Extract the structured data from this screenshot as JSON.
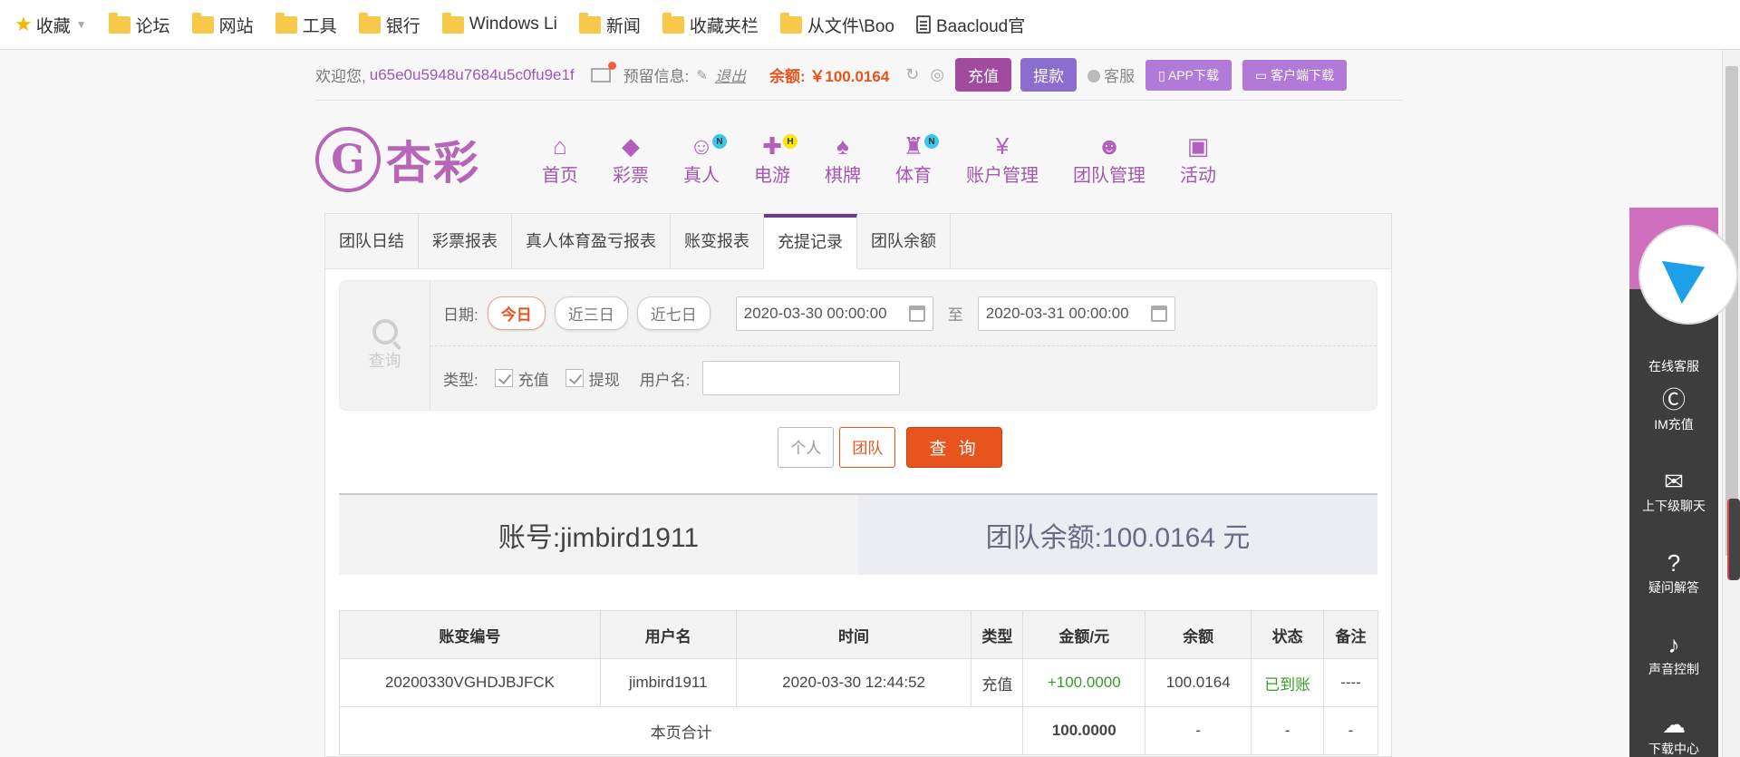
{
  "bookmarks": {
    "favorites": "收藏",
    "items": [
      "论坛",
      "网站",
      "工具",
      "银行",
      "Windows Li",
      "新闻",
      "收藏夹栏",
      "从文件\\Boo",
      "Baacloud官"
    ]
  },
  "topbar": {
    "welcome": "欢迎您,",
    "username": "u65e0u5948u7684u5c0fu9e1f",
    "reserve_label": "预留信息:",
    "logout": "退出",
    "balance": "余额: ￥100.0164",
    "recharge": "充值",
    "withdraw": "提款",
    "service": "客服",
    "app_download": "APP下载",
    "client_download": "客户端下载"
  },
  "logo": {
    "mark": "G",
    "text": "杏彩"
  },
  "nav": [
    {
      "label": "首页",
      "icon": "⌂",
      "badge": ""
    },
    {
      "label": "彩票",
      "icon": "◆",
      "badge": ""
    },
    {
      "label": "真人",
      "icon": "☺",
      "badge": "N"
    },
    {
      "label": "电游",
      "icon": "✚",
      "badge": "H"
    },
    {
      "label": "棋牌",
      "icon": "♠",
      "badge": ""
    },
    {
      "label": "体育",
      "icon": "♜",
      "badge": "N"
    },
    {
      "label": "账户管理",
      "icon": "¥",
      "badge": ""
    },
    {
      "label": "团队管理",
      "icon": "☻",
      "badge": ""
    },
    {
      "label": "活动",
      "icon": "▣",
      "badge": ""
    }
  ],
  "tabs": [
    "团队日结",
    "彩票报表",
    "真人体育盈亏报表",
    "账变报表",
    "充提记录",
    "团队余额"
  ],
  "filter": {
    "query_label": "查询",
    "date_label": "日期:",
    "today": "今日",
    "three_days": "近三日",
    "seven_days": "近七日",
    "start": "2020-03-30 00:00:00",
    "to": "至",
    "end": "2020-03-31 00:00:00",
    "type_label": "类型:",
    "type_recharge": "充值",
    "type_withdraw": "提现",
    "username_label": "用户名:",
    "username_value": ""
  },
  "buttons": {
    "personal": "个人",
    "team": "团队",
    "query": "查 询"
  },
  "summary": {
    "account": "账号:jimbird1911",
    "team_balance": "团队余额:100.0164 元"
  },
  "table": {
    "headers": [
      "账变编号",
      "用户名",
      "时间",
      "类型",
      "金额/元",
      "余额",
      "状态",
      "备注"
    ],
    "rows": [
      [
        "20200330VGHDJBJFCK",
        "jimbird1911",
        "2020-03-30 12:44:52",
        "充值",
        "+100.0000",
        "100.0164",
        "已到账",
        "----"
      ]
    ],
    "subtotal_label": "本页合计",
    "subtotal_amount": "100.0000",
    "dash": "-"
  },
  "float_menu": [
    {
      "label": "在线客服",
      "icon": "☎"
    },
    {
      "label": "IM充值",
      "icon": "Ⓒ"
    },
    {
      "label": "上下级聊天",
      "icon": "✉"
    },
    {
      "label": "疑问解答",
      "icon": "?"
    },
    {
      "label": "声音控制",
      "icon": "♪"
    },
    {
      "label": "下载中心",
      "icon": "☁"
    }
  ]
}
